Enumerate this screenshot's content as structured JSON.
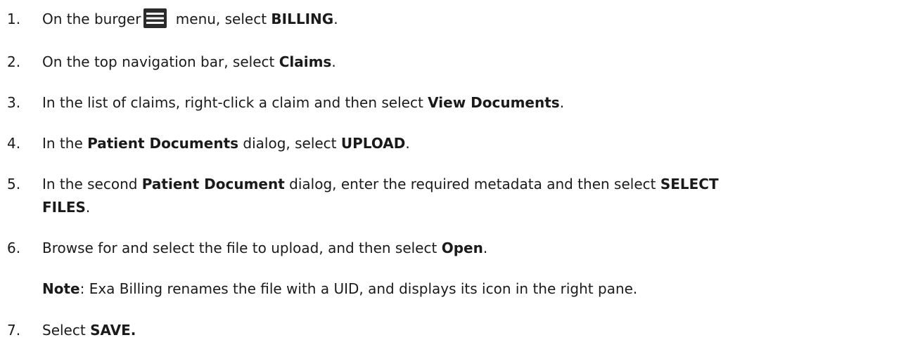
{
  "steps": [
    {
      "num": "1.",
      "t1": "On the burger",
      "t2": " menu, select ",
      "b1": "BILLING",
      "t3": "."
    },
    {
      "num": "2.",
      "t1": "On the top navigation bar, select ",
      "b1": "Claims",
      "t2": "."
    },
    {
      "num": "3.",
      "t1": "In the list of claims, right-click a claim and then select ",
      "b1": "View Documents",
      "t2": "."
    },
    {
      "num": "4.",
      "t1": "In the ",
      "b1": "Patient Documents",
      "t2": " dialog, select ",
      "b2": "UPLOAD",
      "t3": "."
    },
    {
      "num": "5.",
      "t1": "In the second ",
      "b1": "Patient Document",
      "t2": " dialog, enter the required metadata and then select ",
      "b2": "SELECT",
      "b3": "FILES",
      "t3": "."
    },
    {
      "num": "6.",
      "t1": "Browse for and select the file to upload, and then select ",
      "b1": "Open",
      "t2": "."
    },
    {
      "num": "7.",
      "t1": "Select ",
      "b1": "SAVE."
    }
  ],
  "note": {
    "label": "Note",
    "text": ": Exa Billing renames the file with a UID, and displays its icon in the right pane."
  },
  "icons": {
    "burger": "burger-menu-icon"
  }
}
